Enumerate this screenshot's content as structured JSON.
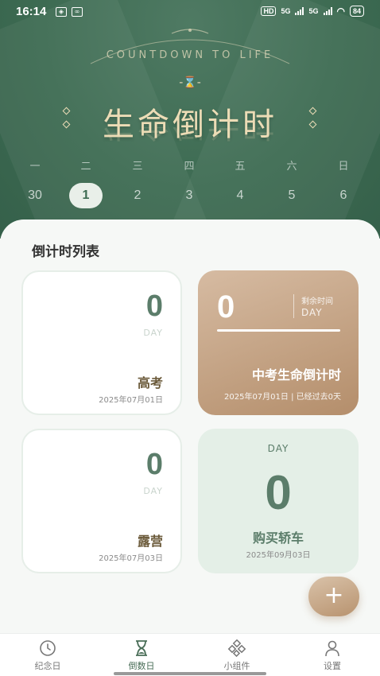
{
  "status_bar": {
    "time": "16:14",
    "network_1": "HD",
    "network_2": "5G",
    "network_3": "5G",
    "battery": "84"
  },
  "hero": {
    "subtitle": "COUNTDOWN TO LIFE",
    "hourglass_glyph": "-⌛-",
    "title": "生命倒计时",
    "weekdays": [
      "一",
      "二",
      "三",
      "四",
      "五",
      "六",
      "日"
    ],
    "dates": [
      "30",
      "1",
      "2",
      "3",
      "4",
      "5",
      "6"
    ],
    "selected_date": "1"
  },
  "list": {
    "title": "倒计时列表",
    "cards": [
      {
        "number": "0",
        "unit": "DAY",
        "name": "高考",
        "date": "2025年07月01日"
      },
      {
        "number": "0",
        "remain_label": "剩余时间",
        "unit": "DAY",
        "name": "中考生命倒计时",
        "date": "2025年07月01日 | 已经过去0天"
      },
      {
        "number": "0",
        "unit": "DAY",
        "name": "露营",
        "date": "2025年07月03日"
      },
      {
        "number": "0",
        "unit": "DAY",
        "name": "购买轿车",
        "date": "2025年09月03日"
      }
    ]
  },
  "fab": {
    "label": "+"
  },
  "tabs": [
    {
      "label": "纪念日",
      "icon": "clock-icon"
    },
    {
      "label": "倒数日",
      "icon": "hourglass-icon"
    },
    {
      "label": "小组件",
      "icon": "widgets-icon"
    },
    {
      "label": "设置",
      "icon": "user-icon"
    }
  ],
  "colors": {
    "hero_green": "#3d6b52",
    "accent_gold": "#b48e6b",
    "mint": "#e4efe7"
  }
}
